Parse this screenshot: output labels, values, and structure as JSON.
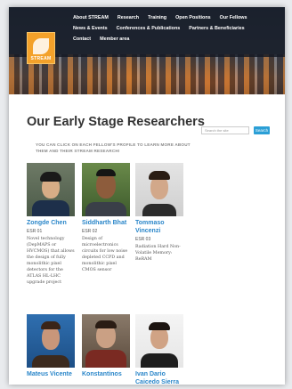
{
  "logo": {
    "text": "STREAM"
  },
  "nav": {
    "row1": [
      "About STREAM",
      "Research",
      "Training",
      "Open Positions",
      "Our Fellows"
    ],
    "row2": [
      "News & Events",
      "Conferences & Publications",
      "Partners & Beneficiaries"
    ],
    "row3": [
      "Contact",
      "Member area"
    ]
  },
  "page": {
    "title": "Our Early Stage Researchers",
    "intro": "YOU CAN CLICK ON EACH FELLOW'S PROFILE TO LEARN MORE ABOUT THEM AND THEIR STREAM RESEARCH!"
  },
  "search": {
    "placeholder": "Search the site",
    "button": "Search"
  },
  "researchers": [
    {
      "name": "Zongde Chen",
      "role": "ESR 01",
      "desc": "Novel technology (DepMAPS or HVCMOS) that allows the design of fully monolithic pixel detectors for the ATLAS HL-LHC upgrade project"
    },
    {
      "name": "Siddharth Bhat",
      "role": "ESR 02",
      "desc": "Design of microelectronics circuits for low noise depleted CCPD and monolithic pixel CMOS sensor"
    },
    {
      "name": "Tommaso Vincenzi",
      "role": "ESR 03",
      "desc": "Radiation Hard Non-Volatile Memory: ReRAM"
    },
    {
      "name": "Mateus Vicente",
      "role": "",
      "desc": ""
    },
    {
      "name": "Konstantinos",
      "role": "",
      "desc": ""
    },
    {
      "name": "Ivan Dario Caicedo Sierra",
      "role": "",
      "desc": ""
    }
  ],
  "colors": {
    "accent": "#2a86c9",
    "nav_bg": "#1e2532",
    "logo": "#f3a12a"
  }
}
